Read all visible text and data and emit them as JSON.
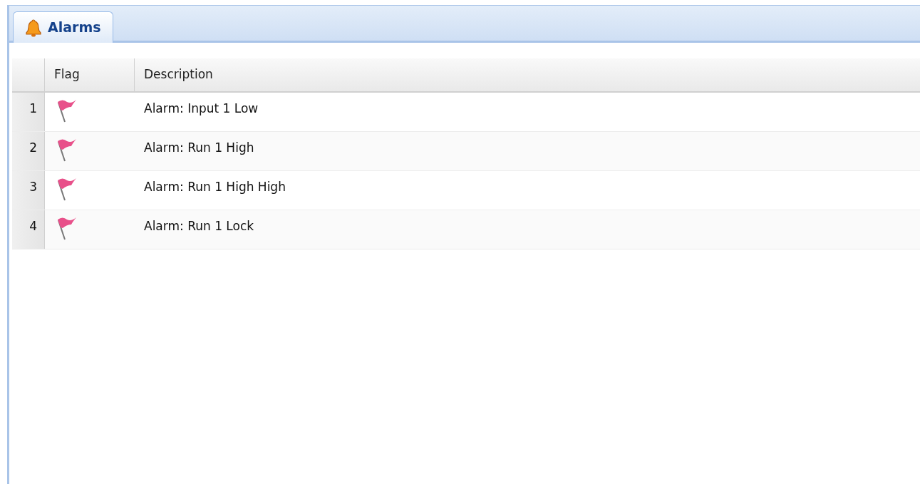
{
  "tabs": [
    {
      "label": "Alarms",
      "selected": true
    }
  ],
  "table": {
    "columns": [
      "Flag",
      "Description"
    ],
    "rows": [
      {
        "number": "1",
        "flagged": true,
        "description": "Alarm: Input 1 Low"
      },
      {
        "number": "2",
        "flagged": true,
        "description": "Alarm: Run 1 High"
      },
      {
        "number": "3",
        "flagged": true,
        "description": "Alarm: Run 1 High High"
      },
      {
        "number": "4",
        "flagged": true,
        "description": "Alarm: Run 1 Lock"
      }
    ]
  }
}
